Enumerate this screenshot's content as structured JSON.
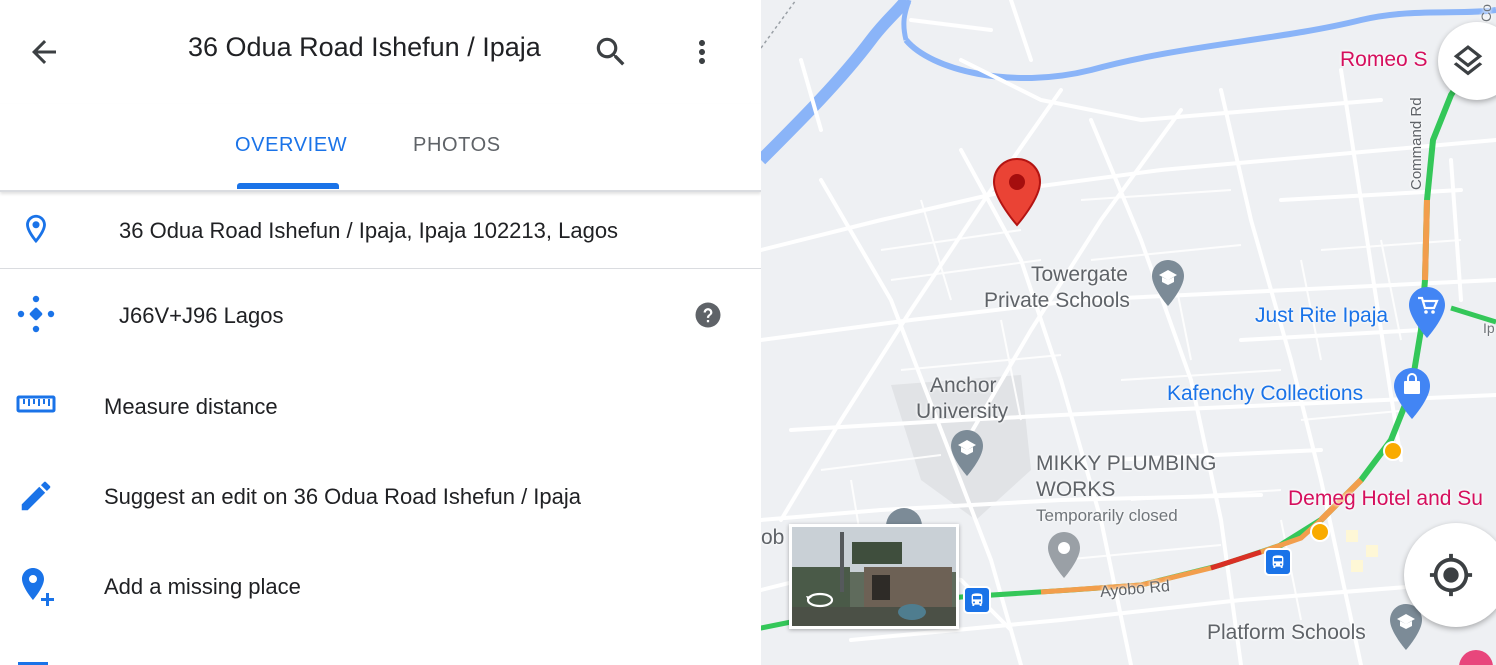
{
  "header": {
    "title": "36 Odua Road Ishefun / Ipaja",
    "back_icon": "arrow-back-icon",
    "search_icon": "search-icon",
    "more_icon": "more-vert-icon"
  },
  "tabs": [
    {
      "label": "OVERVIEW",
      "active": true
    },
    {
      "label": "PHOTOS",
      "active": false
    }
  ],
  "details": {
    "address": "36 Odua Road Ishefun / Ipaja, Ipaja 102213, Lagos",
    "plus_code": "J66V+J96 Lagos",
    "measure": "Measure distance",
    "suggest_edit": "Suggest an edit on 36 Odua Road Ishefun / Ipaja",
    "add_place": "Add a missing place"
  },
  "map": {
    "labels": {
      "romeo": "Romeo S",
      "towergate_1": "Towergate",
      "towergate_2": "Private Schools",
      "just_rite": "Just Rite Ipaja",
      "anchor_1": "Anchor",
      "anchor_2": "University",
      "kafenchy": "Kafenchy Collections",
      "mikky_1": "MIKKY PLUMBING",
      "mikky_2": "WORKS",
      "temp_closed": "Temporarily closed",
      "demeg": "Demeg Hotel and Su",
      "ayobo": "Ayobo Rd",
      "platform": "Platform Schools",
      "command_rd": "Command Rd",
      "ob": "ob",
      "ip": "Ip",
      "co": "Co"
    }
  },
  "colors": {
    "accent": "#1a73e8",
    "pin": "#ea4335",
    "traffic_green": "#34c759",
    "traffic_orange": "#f29e4c",
    "traffic_red": "#d93025"
  }
}
